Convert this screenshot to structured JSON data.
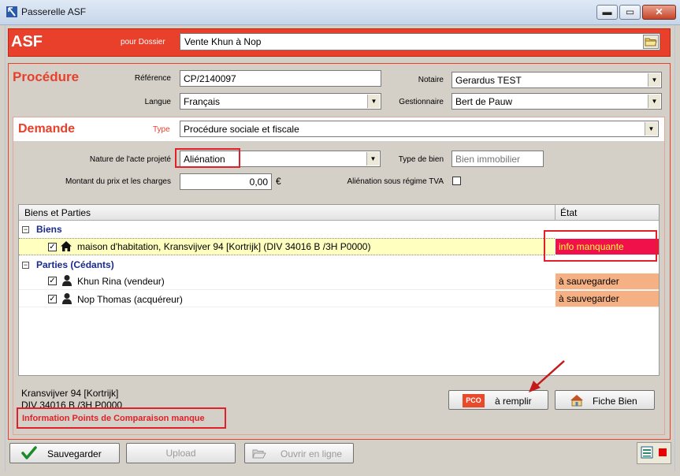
{
  "window": {
    "title": "Passerelle ASF",
    "min_glyph": "▬",
    "max_glyph": "▭",
    "close_glyph": "✕"
  },
  "header": {
    "app_label": "ASF",
    "pour_dossier_label": "pour Dossier",
    "dossier_value": "Vente Khun à Nop"
  },
  "procedure": {
    "section_title": "Procédure",
    "reference_label": "Référence",
    "reference_value": "CP/2140097",
    "langue_label": "Langue",
    "langue_value": "Français",
    "notaire_label": "Notaire",
    "notaire_value": "Gerardus TEST",
    "gestionnaire_label": "Gestionnaire",
    "gestionnaire_value": "Bert de Pauw"
  },
  "demande": {
    "section_title": "Demande",
    "type_label": "Type",
    "type_value": "Procédure sociale et fiscale",
    "nature_label": "Nature de l'acte projeté",
    "nature_value": "Aliénation",
    "type_bien_label": "Type de bien",
    "type_bien_placeholder": "Bien immobilier",
    "montant_label": "Montant du prix et les charges",
    "montant_value": "0,00",
    "currency": "€",
    "tva_label": "Aliénation sous régime TVA"
  },
  "grid": {
    "col_biens": "Biens et Parties",
    "col_etat": "État",
    "groups": [
      {
        "label": "Biens",
        "rows": [
          {
            "text": "maison d'habitation, Kransvijver 94 [Kortrijk] (DIV 34016 B /3H P0000)",
            "state": "info manquante",
            "icon": "house-icon"
          }
        ]
      },
      {
        "label": "Parties (Cédants)",
        "rows": [
          {
            "text": "Khun Rina (vendeur)",
            "state": "à sauvegarder",
            "icon": "person-icon"
          },
          {
            "text": "Nop Thomas (acquéreur)",
            "state": "à sauvegarder",
            "icon": "person-icon"
          }
        ]
      }
    ]
  },
  "info": {
    "line1": "Kransvijver 94 [Kortrijk]",
    "line2": "DIV 34016 B /3H P0000",
    "warning": "Information Points de Comparaison manque"
  },
  "buttons": {
    "pco_badge": "PCO",
    "remplir": "à remplir",
    "fiche_bien": "Fiche Bien",
    "sauvegarder": "Sauvegarder",
    "upload": "Upload",
    "ouvrir": "Ouvrir en ligne"
  },
  "colors": {
    "accent": "#e8402b",
    "state_missing": "#f0104a",
    "state_save": "#f5b183",
    "highlight_row": "#ffffc0"
  }
}
